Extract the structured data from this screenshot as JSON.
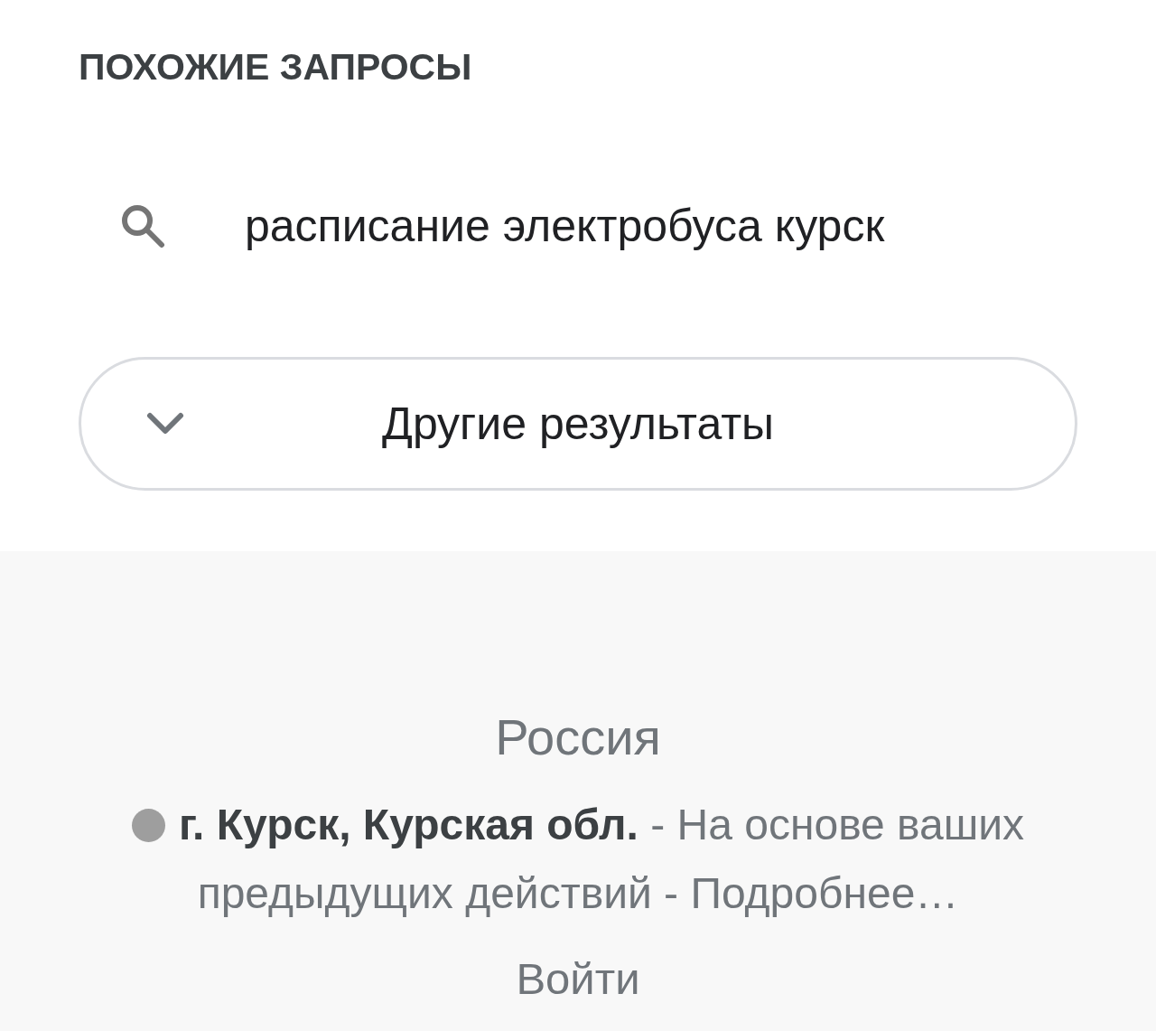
{
  "related_searches": {
    "heading": "ПОХОЖИЕ ЗАПРОСЫ",
    "items": [
      {
        "text": "расписание электробуса курск"
      }
    ]
  },
  "more_results_button": {
    "label": "Другие результаты"
  },
  "footer": {
    "country": "Россия",
    "location": {
      "text": "**г. Курск, Курская обл.** - На основе ваших предыдущих действий -",
      "link": "Подробнее…"
    },
    "sign_in": "Войти"
  }
}
